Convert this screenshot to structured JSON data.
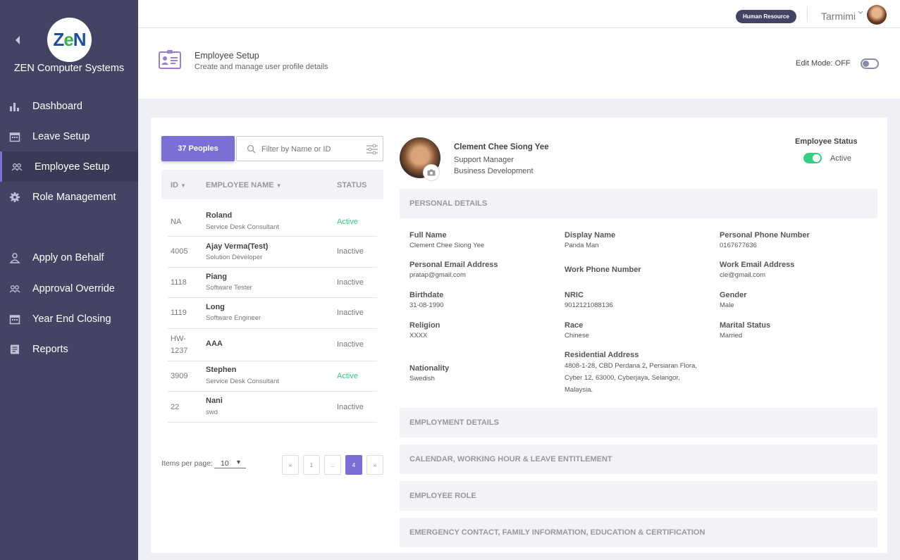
{
  "sidebar": {
    "logo_text": "ZeN",
    "company": "ZEN Computer Systems",
    "items": [
      {
        "label": "Dashboard",
        "icon": "bar-chart-icon"
      },
      {
        "label": "Leave Setup",
        "icon": "calendar-icon"
      },
      {
        "label": "Employee Setup",
        "icon": "users-icon",
        "active": true
      },
      {
        "label": "Role Management",
        "icon": "gear-icon"
      },
      {
        "label": "Apply on Behalf",
        "icon": "user-icon"
      },
      {
        "label": "Approval Override",
        "icon": "users-icon"
      },
      {
        "label": "Year End Closing",
        "icon": "calendar-icon"
      },
      {
        "label": "Reports",
        "icon": "report-icon"
      }
    ]
  },
  "topbar": {
    "badge": "Human Resource",
    "username": "Tarmimi"
  },
  "header": {
    "title": "Employee Setup",
    "subtitle": "Create and manage user profile details",
    "edit_mode": "Edit Mode: OFF"
  },
  "list": {
    "people_button": "37 Peoples",
    "search_placeholder": "Filter by Name or ID",
    "columns": {
      "id": "ID",
      "name": "EMPLOYEE NAME",
      "status": "STATUS"
    },
    "rows": [
      {
        "id": "NA",
        "name": "Roland",
        "role": "Service Desk Consultant",
        "status": "Active"
      },
      {
        "id": "4005",
        "name": "Ajay Verma(Test)",
        "role": "Solution Developer",
        "status": "Inactive"
      },
      {
        "id": "1118",
        "name": "Piang",
        "role": "Software Tester",
        "status": "Inactive"
      },
      {
        "id": "1119",
        "name": "Long",
        "role": "Software Engineer",
        "status": "Inactive"
      },
      {
        "id": "HW-1237",
        "name": "AAA",
        "role": "",
        "status": "Inactive"
      },
      {
        "id": "3909",
        "name": "Stephen",
        "role": "Service Desk Consultant",
        "status": "Active"
      },
      {
        "id": "22",
        "name": "Nani",
        "role": "swd",
        "status": "Inactive"
      }
    ],
    "items_per_page_label": "Items per page:",
    "items_per_page": "10",
    "pagination": [
      "«",
      "1",
      "..",
      "4",
      "»"
    ],
    "current_page": "4"
  },
  "profile": {
    "name": "Clement Chee Siong Yee",
    "job": "Support Manager",
    "department": "Business Development",
    "status_label": "Employee Status",
    "status": "Active"
  },
  "sections": {
    "personal": "PERSONAL DETAILS",
    "employment": "EMPLOYMENT DETAILS",
    "calendar": "CALENDAR, WORKING HOUR & LEAVE ENTITLEMENT",
    "role": "EMPLOYEE ROLE",
    "emergency": "EMERGENCY CONTACT, FAMILY INFORMATION, EDUCATION & CERTIFICATION"
  },
  "personal": {
    "full_name": {
      "label": "Full Name",
      "value": "Clement Chee Siong Yee"
    },
    "display_name": {
      "label": "Display Name",
      "value": "Panda Man"
    },
    "personal_phone": {
      "label": "Personal Phone Number",
      "value": "0167677636"
    },
    "personal_email": {
      "label": "Personal Email Address",
      "value": "pratap@gmail.com"
    },
    "work_phone": {
      "label": "Work Phone Number",
      "value": ""
    },
    "work_email": {
      "label": "Work Email Address",
      "value": "cle@gmail.com"
    },
    "birthdate": {
      "label": "Birthdate",
      "value": "31-08-1990"
    },
    "nric": {
      "label": "NRIC",
      "value": "9012121088136"
    },
    "gender": {
      "label": "Gender",
      "value": "Male"
    },
    "religion": {
      "label": "Religion",
      "value": "XXXX"
    },
    "race": {
      "label": "Race",
      "value": "Chinese"
    },
    "marital": {
      "label": "Marital Status",
      "value": "Married"
    },
    "nationality": {
      "label": "Nationality",
      "value": "Swedish"
    },
    "address": {
      "label": "Residential Address",
      "lines": [
        "4808-1-28, CBD Perdana 2, Persiaran Flora,",
        "Cyber 12, 63000, Cyberjaya, Selangor,",
        "Malaysia."
      ]
    }
  },
  "colors": {
    "accent": "#7b6fd6",
    "sidebar": "#434363",
    "active": "#35d07f"
  }
}
